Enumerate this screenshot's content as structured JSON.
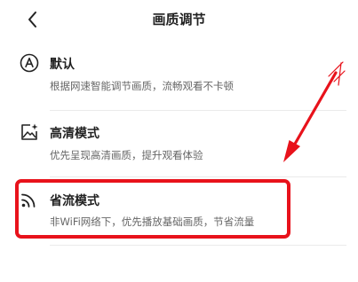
{
  "header": {
    "back_icon": "chevron-left-icon",
    "title": "画质调节"
  },
  "options": [
    {
      "icon": "auto-a-icon",
      "title": "默认",
      "description": "根据网速智能调节画质，流畅观看不卡顿"
    },
    {
      "icon": "hd-image-icon",
      "title": "高清模式",
      "description": "优先呈现高清画质，提升观看体验"
    },
    {
      "icon": "signal-icon",
      "title": "省流模式",
      "description": "非WiFi网络下，优先播放基础画质，节省流量"
    }
  ],
  "annotation": {
    "highlight_color": "#e8121b",
    "highlighted_option": "省流模式"
  }
}
